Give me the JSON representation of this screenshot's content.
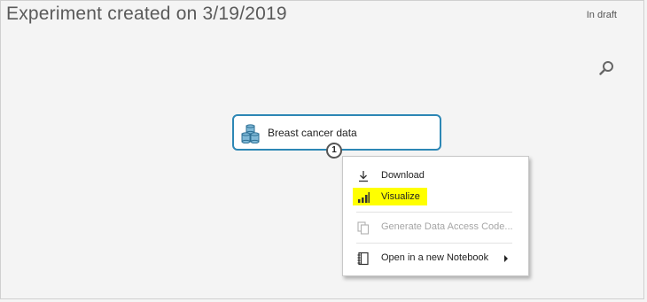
{
  "header": {
    "title": "Experiment created on 3/19/2019",
    "status": "In draft"
  },
  "module": {
    "label": "Breast cancer data",
    "output_port": "1",
    "icon": "dataset-icon"
  },
  "context_menu": {
    "items": [
      {
        "label": "Download",
        "icon": "download-icon",
        "enabled": true
      },
      {
        "label": "Visualize",
        "icon": "bar-chart-icon",
        "enabled": true,
        "highlighted": true
      },
      {
        "label": "Generate Data Access Code...",
        "icon": "copy-code-icon",
        "enabled": false
      },
      {
        "label": "Open in a new Notebook",
        "icon": "notebook-icon",
        "enabled": true,
        "has_submenu": true
      }
    ]
  },
  "colors": {
    "module_border": "#2d87b5",
    "highlight": "#ffff00",
    "disabled_text": "#a6a6a6"
  }
}
